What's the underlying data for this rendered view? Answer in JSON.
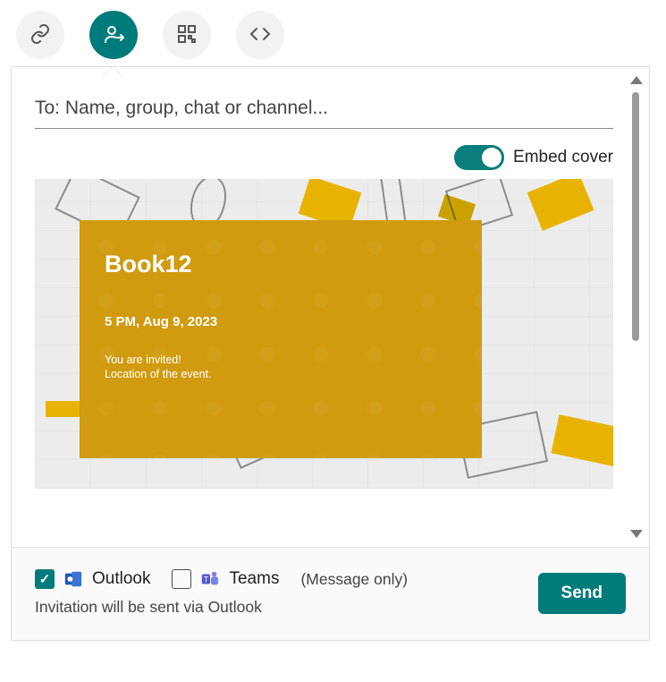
{
  "tabs": {
    "link_icon": "link-icon",
    "share_icon": "share-person-icon",
    "qr_icon": "qr-icon",
    "embed_icon": "code-icon"
  },
  "to_placeholder": "To: Name, group, chat or channel...",
  "embed_toggle": {
    "label": "Embed cover",
    "on": true
  },
  "cover": {
    "title": "Book12",
    "datetime": "5 PM, Aug 9, 2023",
    "invite_line": "You are invited!",
    "location_line": "Location of the event."
  },
  "footer": {
    "outlook": {
      "checked": true,
      "label": "Outlook"
    },
    "teams": {
      "checked": false,
      "label": "Teams"
    },
    "hint": "(Message only)",
    "subtext": "Invitation will be sent via Outlook",
    "send": "Send"
  }
}
